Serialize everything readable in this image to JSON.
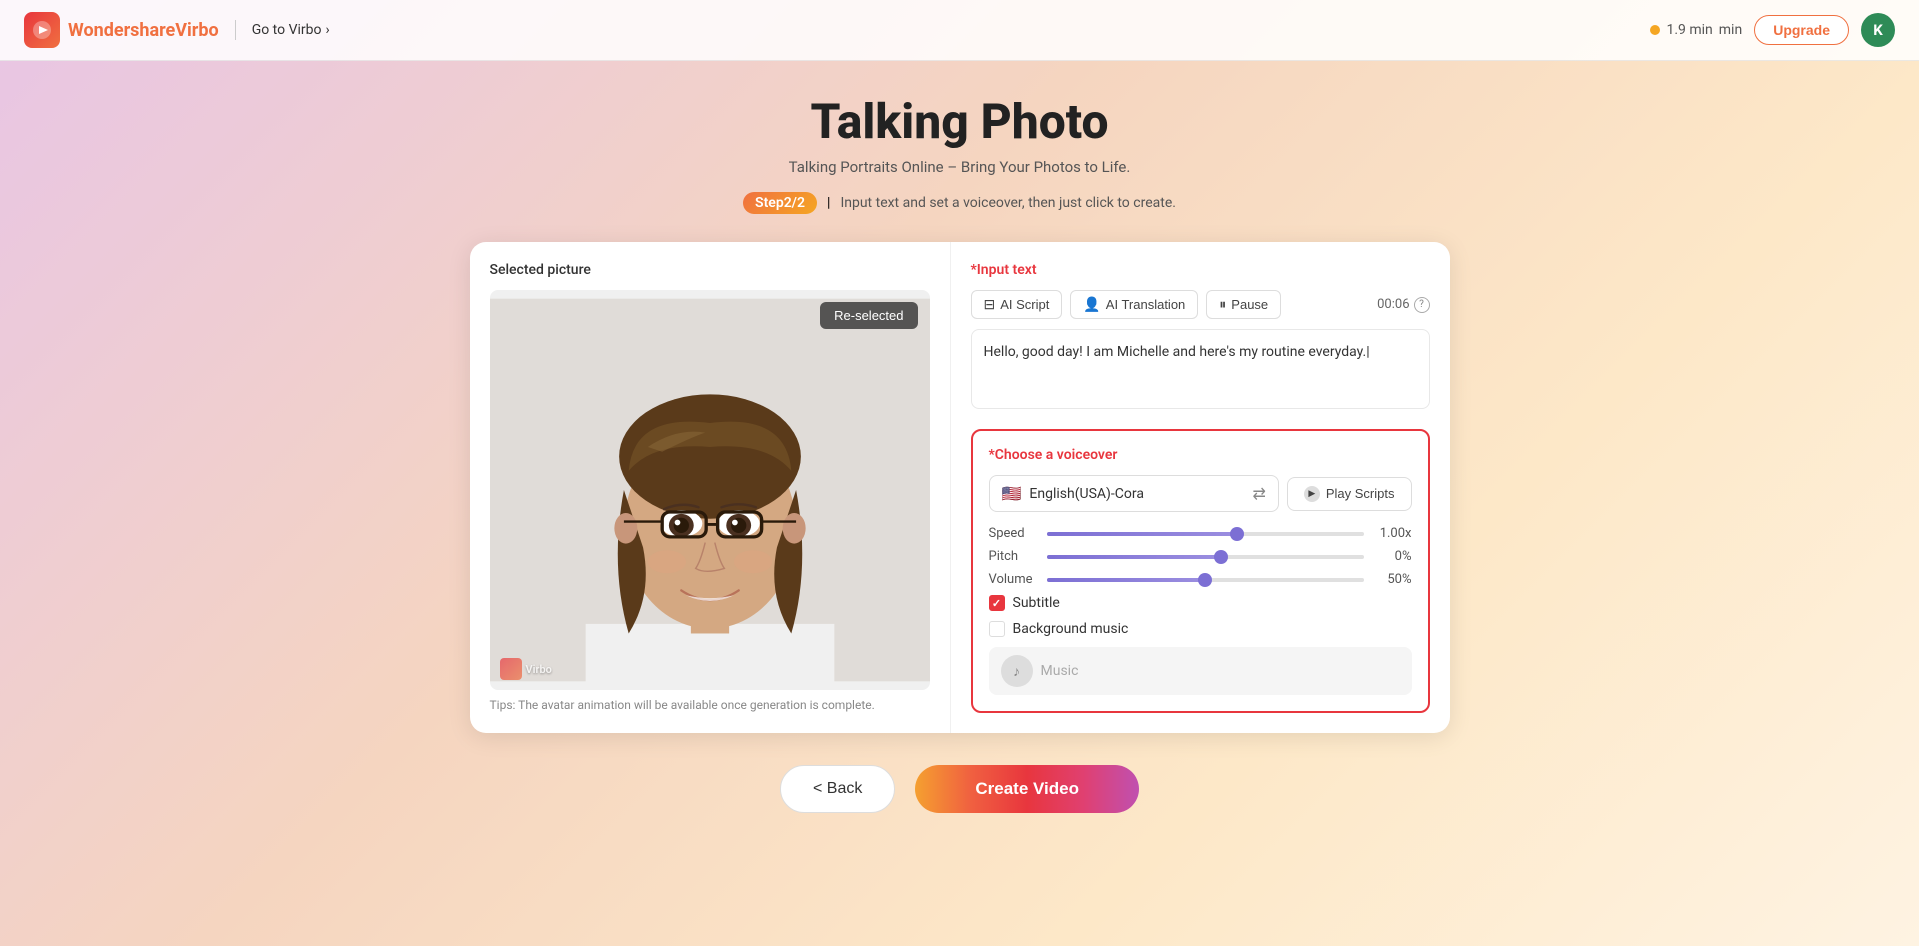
{
  "header": {
    "logo_name": "Wondershare",
    "logo_brand": "Virbo",
    "goto_label": "Go to Virbo",
    "credits": "1.9 min",
    "upgrade_label": "Upgrade",
    "avatar_initial": "K"
  },
  "page": {
    "title": "Talking Photo",
    "subtitle": "Talking Portraits Online – Bring Your Photos to Life.",
    "step_label": "Step2/2",
    "step_desc": "Input text and set a voiceover, then just click to create."
  },
  "left_panel": {
    "section_label": "Selected picture",
    "reselect_label": "Re-selected",
    "tip": "Tips: The avatar animation will be available once generation is complete.",
    "watermark": "Virbo"
  },
  "right_panel": {
    "input_label": "*Input text",
    "ai_script_label": "AI Script",
    "ai_translation_label": "AI Translation",
    "pause_label": "Pause",
    "time_display": "00:06",
    "input_text": "Hello, good day! I am Michelle and here's my routine everyday.|",
    "voiceover_title": "*Choose a voiceover",
    "voice_name": "English(USA)-Cora",
    "play_scripts_label": "Play Scripts",
    "speed_label": "Speed",
    "speed_value": "1.00x",
    "speed_pct": 60,
    "pitch_label": "Pitch",
    "pitch_value": "0%",
    "pitch_pct": 55,
    "volume_label": "Volume",
    "volume_value": "50%",
    "volume_pct": 50,
    "subtitle_label": "Subtitle",
    "subtitle_checked": true,
    "bg_music_label": "Background music",
    "bg_music_checked": false,
    "music_label": "Music"
  },
  "footer": {
    "back_label": "< Back",
    "create_label": "Create Video"
  }
}
